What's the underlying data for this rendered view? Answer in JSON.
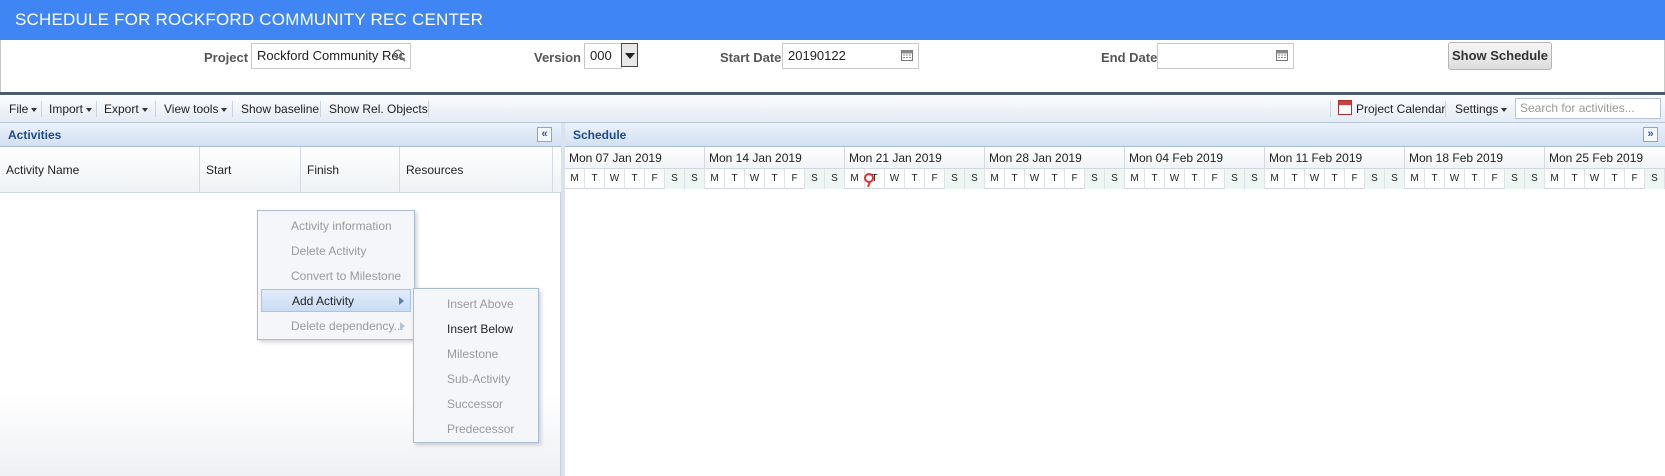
{
  "app_title": "SCHEDULE FOR ROCKFORD COMMUNITY REC CENTER",
  "params": {
    "project_label": "Project",
    "project_value": "Rockford Community Rec",
    "version_label": "Version",
    "version_value": "000",
    "start_label": "Start Date",
    "start_value": "20190122",
    "end_label": "End Date",
    "end_value": "",
    "show_button": "Show Schedule"
  },
  "toolbar": {
    "file": "File",
    "import": "Import",
    "export": "Export",
    "view_tools": "View tools",
    "show_baseline": "Show baseline",
    "show_rel": "Show Rel. Objects",
    "project_calendar": "Project Calendar",
    "settings": "Settings",
    "search_placeholder": "Search for activities..."
  },
  "activities_panel": {
    "title": "Activities",
    "columns": [
      "Activity Name",
      "Start",
      "Finish",
      "Resources"
    ]
  },
  "schedule_panel": {
    "title": "Schedule",
    "weeks": [
      "Mon 07 Jan 2019",
      "Mon 14 Jan 2019",
      "Mon 21 Jan 2019",
      "Mon 28 Jan 2019",
      "Mon 04 Feb 2019",
      "Mon 11 Feb 2019",
      "Mon 18 Feb 2019",
      "Mon 25 Feb 2019"
    ],
    "day_letters": [
      "M",
      "T",
      "W",
      "T",
      "F",
      "S",
      "S"
    ]
  },
  "context_menu": {
    "items": [
      {
        "label": "Activity information",
        "enabled": false
      },
      {
        "label": "Delete Activity",
        "enabled": false
      },
      {
        "label": "Convert to Milestone",
        "enabled": false
      },
      {
        "label": "Add Activity",
        "enabled": true
      },
      {
        "label": "Delete dependency...",
        "enabled": false
      }
    ]
  },
  "submenu": {
    "items": [
      {
        "label": "Insert Above",
        "enabled": false
      },
      {
        "label": "Insert Below",
        "enabled": true
      },
      {
        "label": "Milestone",
        "enabled": false
      },
      {
        "label": "Sub-Activity",
        "enabled": false
      },
      {
        "label": "Successor",
        "enabled": false
      },
      {
        "label": "Predecessor",
        "enabled": false
      }
    ]
  },
  "colors": {
    "title_bar": "#3f86f4",
    "panel_header_text": "#1d4a8a",
    "today_marker": "#e03030"
  }
}
